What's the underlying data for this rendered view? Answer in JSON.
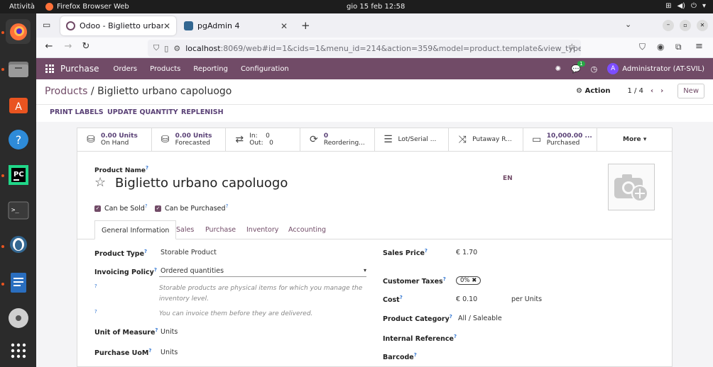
{
  "system": {
    "activities": "Attività",
    "app_name": "Firefox Browser Web",
    "clock": "gio 15 feb  12:58"
  },
  "browser": {
    "tabs": [
      {
        "label": "Odoo - Biglietto urbano c",
        "active": true
      },
      {
        "label": "pgAdmin 4",
        "active": false
      }
    ],
    "url_host": "localhost",
    "url_rest": ":8069/web#id=1&cids=1&menu_id=214&action=359&model=product.template&view_type=f"
  },
  "odoo_nav": {
    "app": "Purchase",
    "menus": [
      "Orders",
      "Products",
      "Reporting",
      "Configuration"
    ],
    "message_count": "1",
    "user_initial": "A",
    "user": "Administrator (AT-SVIL)"
  },
  "control": {
    "breadcrumb_parent": "Products",
    "breadcrumb_sep": "/",
    "breadcrumb_current": "Biglietto urbano capoluogo",
    "action_label": "Action",
    "pager": "1 / 4",
    "new_label": "New"
  },
  "status_buttons": [
    "PRINT LABELS",
    "UPDATE QUANTITY",
    "REPLENISH"
  ],
  "smart_buttons": [
    {
      "icon": "cubes-icon",
      "value": "0.00 Units",
      "label": "On Hand"
    },
    {
      "icon": "cubes-icon",
      "value": "0.00 Units",
      "label": "Forecasted"
    },
    {
      "icon": "exchange-icon",
      "value": "In:    0",
      "label": "Out:   0"
    },
    {
      "icon": "refresh-icon",
      "value": "0",
      "label": "Reordering..."
    },
    {
      "icon": "list-icon",
      "value": "",
      "label": "Lot/Serial ..."
    },
    {
      "icon": "random-icon",
      "value": "",
      "label": "Putaway R..."
    },
    {
      "icon": "credit-card-icon",
      "value": "10,000.00 ...",
      "label": "Purchased"
    }
  ],
  "more_label": "More",
  "form": {
    "product_name_label": "Product Name",
    "product_name": "Biglietto urbano capoluogo",
    "lang": "EN",
    "can_be_sold": "Can be Sold",
    "can_be_purchased": "Can be Purchased",
    "tabs": [
      "General Information",
      "Sales",
      "Purchase",
      "Inventory",
      "Accounting"
    ],
    "product_type_label": "Product Type",
    "product_type": "Storable Product",
    "invoicing_policy_label": "Invoicing Policy",
    "invoicing_policy": "Ordered quantities",
    "help_storable": "Storable products are physical items for which you manage the inventory level.",
    "help_invoice": "You can invoice them before they are delivered.",
    "uom_label": "Unit of Measure",
    "uom": "Units",
    "purchase_uom_label": "Purchase UoM",
    "purchase_uom": "Units",
    "sales_price_label": "Sales Price",
    "sales_price": "€ 1.70",
    "customer_taxes_label": "Customer Taxes",
    "customer_tax_tag": "0%",
    "cost_label": "Cost",
    "cost": "€ 0.10",
    "cost_unit": "per Units",
    "product_category_label": "Product Category",
    "product_category": "All / Saleable",
    "internal_ref_label": "Internal Reference",
    "barcode_label": "Barcode"
  }
}
